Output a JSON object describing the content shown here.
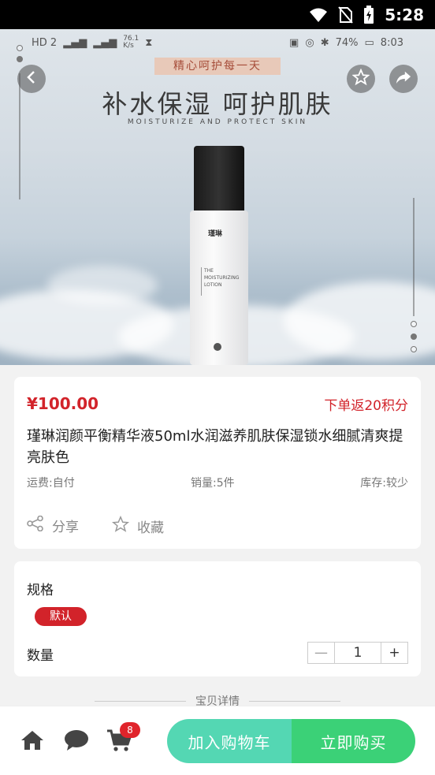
{
  "status_bar": {
    "time": "5:28",
    "icons": [
      "wifi-icon",
      "no-sim-icon",
      "battery-icon"
    ]
  },
  "hero": {
    "inner_status": {
      "net": "HD 2",
      "speed": "76.1\nK/s",
      "battery": "74%",
      "time": "8:03"
    },
    "slogan": "精心呵护每一天",
    "headline": "补水保湿 呵护肌肤",
    "subline": "MOISTURIZE AND PROTECT SKIN",
    "bottle_brand": "瑾琳",
    "bottle_text": [
      "THE",
      "MOISTURIZING",
      "LOTION"
    ]
  },
  "product": {
    "price": "¥100.00",
    "points": "下单返20积分",
    "title": "瑾琳润颜平衡精华液50ml水润滋养肌肤保湿锁水细腻清爽提亮肤色",
    "shipping": "运费:自付",
    "sales": "销量:5件",
    "stock": "库存:较少",
    "share_label": "分享",
    "favorite_label": "收藏"
  },
  "spec": {
    "label": "规格",
    "selected": "默认",
    "qty_label": "数量",
    "minus": "—",
    "qty": "1",
    "plus": "+"
  },
  "detail_divider": "宝贝详情",
  "bottom": {
    "cart_badge": "8",
    "add_to_cart": "加入购物车",
    "buy_now": "立即购买"
  },
  "colors": {
    "accent": "#d2232a",
    "cart_btn": "#54d7b3",
    "buy_btn": "#3bd177"
  }
}
